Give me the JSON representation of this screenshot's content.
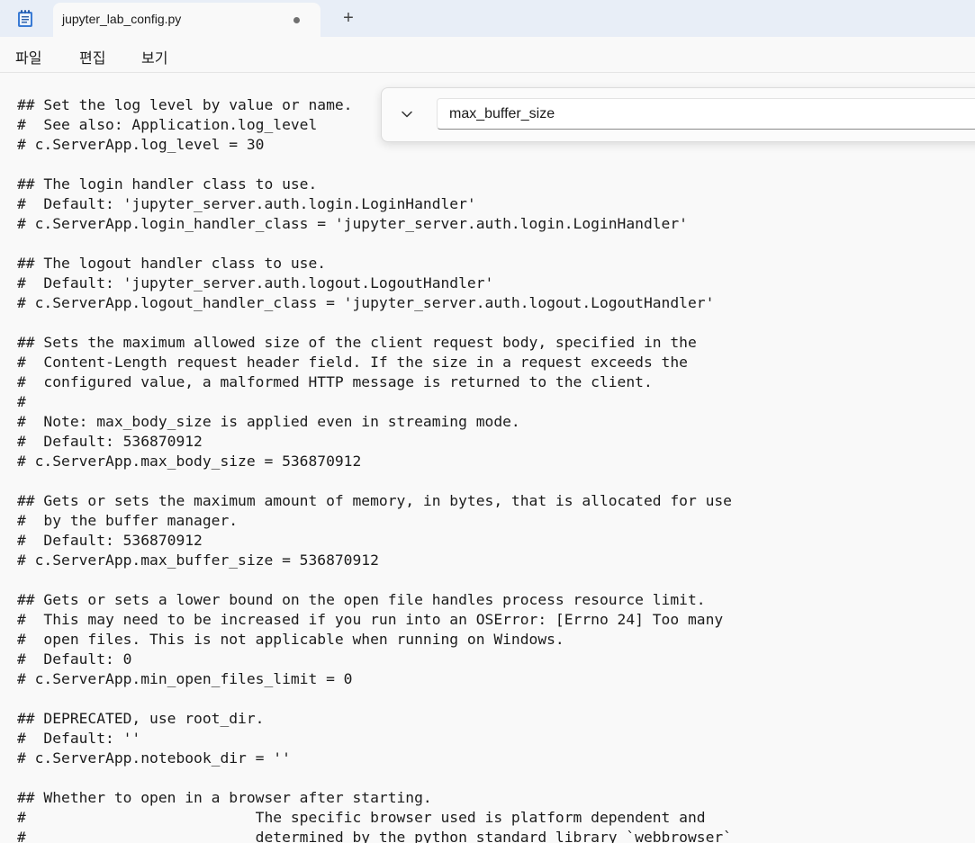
{
  "window": {
    "tab_title": "jupyter_lab_config.py",
    "app_icon": "notepad-icon",
    "unsaved_indicator": "unsaved-dot-icon",
    "new_tab_label": "+"
  },
  "menu": {
    "items": [
      "파일",
      "편집",
      "보기"
    ]
  },
  "find": {
    "toggle_icon": "chevron-down-icon",
    "value": "max_buffer_size"
  },
  "editor": {
    "lines": [
      "## Set the log level by value or name.",
      "#  See also: Application.log_level",
      "# c.ServerApp.log_level = 30",
      "",
      "## The login handler class to use.",
      "#  Default: 'jupyter_server.auth.login.LoginHandler'",
      "# c.ServerApp.login_handler_class = 'jupyter_server.auth.login.LoginHandler'",
      "",
      "## The logout handler class to use.",
      "#  Default: 'jupyter_server.auth.logout.LogoutHandler'",
      "# c.ServerApp.logout_handler_class = 'jupyter_server.auth.logout.LogoutHandler'",
      "",
      "## Sets the maximum allowed size of the client request body, specified in the",
      "#  Content-Length request header field. If the size in a request exceeds the",
      "#  configured value, a malformed HTTP message is returned to the client.",
      "#",
      "#  Note: max_body_size is applied even in streaming mode.",
      "#  Default: 536870912",
      "# c.ServerApp.max_body_size = 536870912",
      "",
      "## Gets or sets the maximum amount of memory, in bytes, that is allocated for use",
      "#  by the buffer manager.",
      "#  Default: 536870912",
      "# c.ServerApp.max_buffer_size = 536870912",
      "",
      "## Gets or sets a lower bound on the open file handles process resource limit.",
      "#  This may need to be increased if you run into an OSError: [Errno 24] Too many",
      "#  open files. This is not applicable when running on Windows.",
      "#  Default: 0",
      "# c.ServerApp.min_open_files_limit = 0",
      "",
      "## DEPRECATED, use root_dir.",
      "#  Default: ''",
      "# c.ServerApp.notebook_dir = ''",
      "",
      "## Whether to open in a browser after starting.",
      "#                          The specific browser used is platform dependent and",
      "#                          determined by the python standard library `webbrowser`"
    ]
  }
}
